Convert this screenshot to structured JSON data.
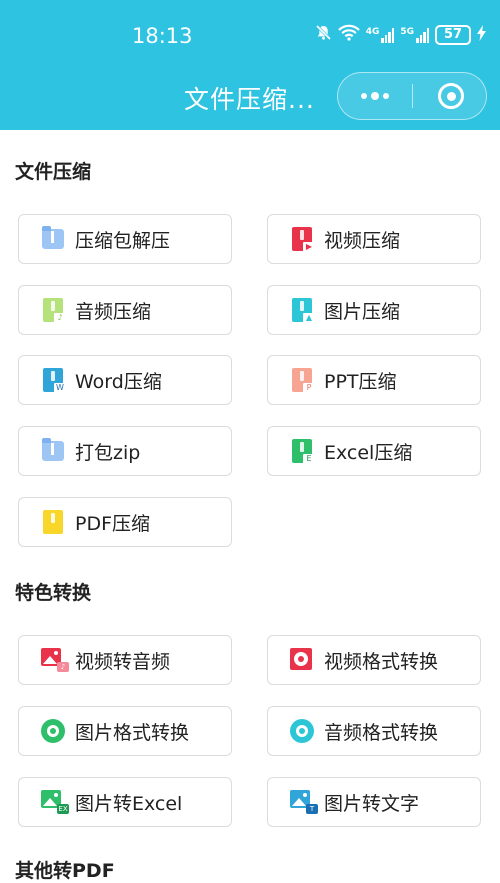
{
  "status_bar": {
    "time": "18:13",
    "network_left": "4G",
    "network_right": "5G",
    "battery": "57"
  },
  "header": {
    "title": "文件压缩..."
  },
  "sections": [
    {
      "title": "文件压缩"
    },
    {
      "title": "特色转换"
    },
    {
      "title": "其他转PDF"
    }
  ],
  "tools": {
    "compress": {
      "zip_unzip": "压缩包解压",
      "video": "视频压缩",
      "audio": "音频压缩",
      "image": "图片压缩",
      "word": "Word压缩",
      "ppt": "PPT压缩",
      "pack_zip": "打包zip",
      "excel": "Excel压缩",
      "pdf": "PDF压缩"
    },
    "convert": {
      "video_to_audio": "视频转音频",
      "video_format": "视频格式转换",
      "image_format": "图片格式转换",
      "audio_format": "音频格式转换",
      "image_to_excel": "图片转Excel",
      "image_to_text": "图片转文字"
    }
  },
  "icon_tags": {
    "word": "W",
    "ppt": "P",
    "excel": "E",
    "image_excel": "EX",
    "image_text": "T"
  },
  "colors": {
    "header": "#2fc3e2",
    "card_border": "#dcdcdc",
    "text": "#222222"
  }
}
